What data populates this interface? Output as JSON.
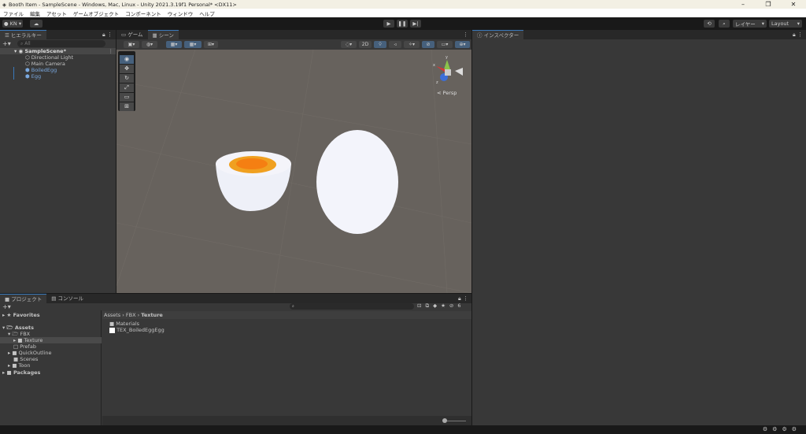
{
  "window": {
    "title": "Booth Item - SampleScene - Windows, Mac, Linux - Unity 2021.3.19f1 Personal* <DX11>",
    "minimize": "–",
    "maximize": "❐",
    "close": "✕"
  },
  "menu": [
    "ファイル",
    "編集",
    "アセット",
    "ゲームオブジェクト",
    "コンポーネント",
    "ウィンドウ",
    "ヘルプ"
  ],
  "toolbar": {
    "account": "KN",
    "layers": "レイヤー",
    "layout": "Layout"
  },
  "hierarchy": {
    "tab": "ヒエラルキー",
    "search_placeholder": "All",
    "scene": "SampleScene*",
    "items": [
      {
        "label": "Directional Light",
        "prefab": false
      },
      {
        "label": "Main Camera",
        "prefab": false
      },
      {
        "label": "BoiledEgg",
        "prefab": true
      },
      {
        "label": "Egg",
        "prefab": true
      }
    ]
  },
  "scene": {
    "tabs": [
      "ゲーム",
      "シーン"
    ],
    "mode_2d": "2D",
    "persp": "Persp",
    "gizmo_axes": {
      "y": "y",
      "x": "x",
      "z": "z"
    }
  },
  "inspector": {
    "tab": "インスペクター"
  },
  "project": {
    "tabs": [
      "プロジェクト",
      "コンソール"
    ],
    "favorites": "Favorites",
    "assets": "Assets",
    "tree": [
      "FBX",
      "Texture",
      "Prefab",
      "QuickOutline",
      "Scenes",
      "Toon"
    ],
    "packages": "Packages",
    "breadcrumb": [
      "Assets",
      "FBX",
      "Texture"
    ],
    "files": [
      "Materials",
      "TEX_BoiledEggEgg"
    ],
    "hidden_count": "6"
  }
}
